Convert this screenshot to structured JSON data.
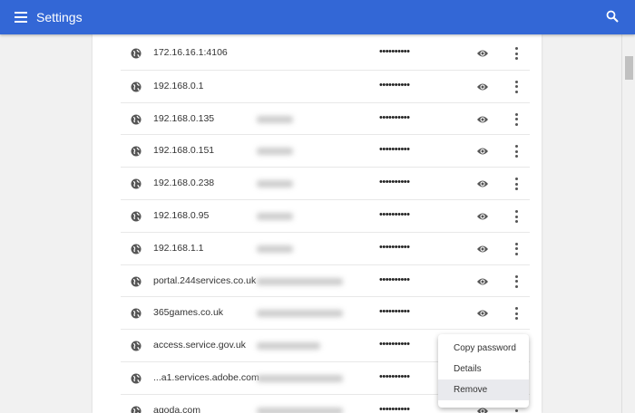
{
  "header": {
    "title": "Settings"
  },
  "rows": [
    {
      "site": "172.16.16.1:4106",
      "user": 0,
      "password": "••••••••••"
    },
    {
      "site": "192.168.0.1",
      "user": 0,
      "password": "••••••••••"
    },
    {
      "site": "192.168.0.135",
      "user": 40,
      "password": "••••••••••"
    },
    {
      "site": "192.168.0.151",
      "user": 40,
      "password": "••••••••••"
    },
    {
      "site": "192.168.0.238",
      "user": 40,
      "password": "••••••••••"
    },
    {
      "site": "192.168.0.95",
      "user": 40,
      "password": "••••••••••"
    },
    {
      "site": "192.168.1.1",
      "user": 40,
      "password": "••••••••••"
    },
    {
      "site": "portal.244services.co.uk",
      "user": 95,
      "password": "••••••••••"
    },
    {
      "site": "365games.co.uk",
      "user": 95,
      "password": "••••••••••"
    },
    {
      "site": "access.service.gov.uk",
      "user": 70,
      "password": "••••••••••"
    },
    {
      "site": "...a1.services.adobe.com",
      "user": 95,
      "password": "••••••••••"
    },
    {
      "site": "agoda.com",
      "user": 95,
      "password": "••••••••••"
    }
  ],
  "context_menu": {
    "items": [
      "Copy password",
      "Details",
      "Remove"
    ]
  }
}
